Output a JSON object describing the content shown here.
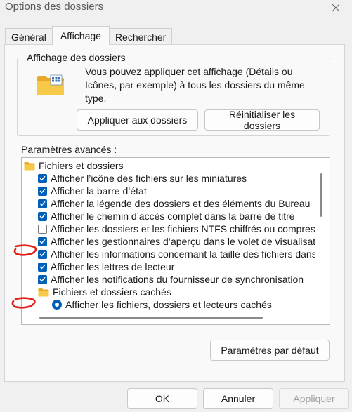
{
  "window": {
    "title": "Options des dossiers",
    "close_icon": "close-icon"
  },
  "tabs": [
    {
      "label": "Général",
      "active": false
    },
    {
      "label": "Affichage",
      "active": true
    },
    {
      "label": "Rechercher",
      "active": false
    }
  ],
  "folder_view": {
    "legend": "Affichage des dossiers",
    "description": "Vous pouvez appliquer cet affichage (Détails ou Icônes, par exemple) à tous les dossiers du même type.",
    "apply_label": "Appliquer aux dossiers",
    "reset_label": "Réinitialiser les dossiers"
  },
  "advanced": {
    "label": "Paramètres avancés :",
    "category": "Fichiers et dossiers",
    "items": [
      {
        "label": "Afficher l’icône des fichiers sur les miniatures",
        "checked": true
      },
      {
        "label": "Afficher la barre d’état",
        "checked": true
      },
      {
        "label": "Afficher la légende des dossiers et des éléments du Bureau",
        "checked": true
      },
      {
        "label": "Afficher le chemin d’accès complet dans la barre de titre",
        "checked": true
      },
      {
        "label": "Afficher les dossiers et les fichiers NTFS chiffrés ou compressés",
        "checked": false
      },
      {
        "label": "Afficher les gestionnaires d’aperçu dans le volet de visualisation",
        "checked": true
      },
      {
        "label": "Afficher les informations concernant la taille des fichiers dans le",
        "checked": true
      },
      {
        "label": "Afficher les lettres de lecteur",
        "checked": true
      },
      {
        "label": "Afficher les notifications du fournisseur de synchronisation",
        "checked": true
      }
    ],
    "subcategory": "Fichiers et dossiers cachés",
    "radio_label": "Afficher les fichiers, dossiers et lecteurs cachés"
  },
  "buttons": {
    "defaults": "Paramètres par défaut",
    "ok": "OK",
    "cancel": "Annuler",
    "apply": "Appliquer"
  },
  "colors": {
    "accent": "#005fb8",
    "annotation": "#e0201a"
  }
}
